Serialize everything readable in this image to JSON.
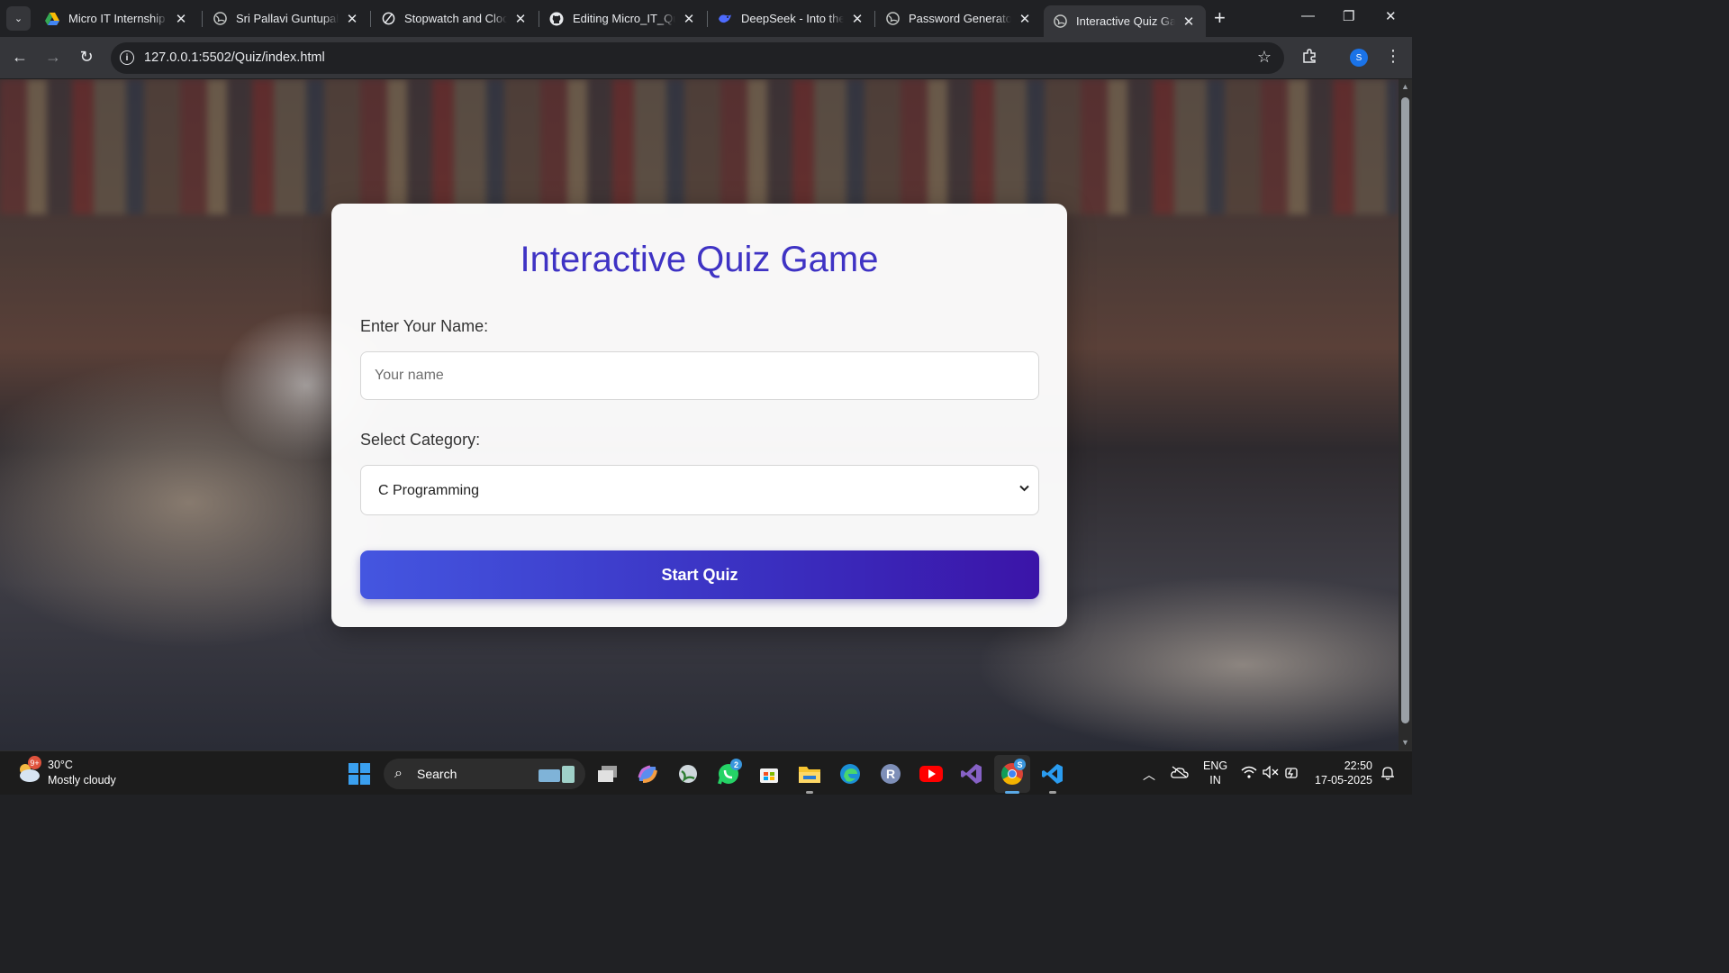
{
  "browser": {
    "tabs": [
      {
        "title": "Micro IT Internship P",
        "favicon": "google-drive-icon"
      },
      {
        "title": "Sri Pallavi Guntupalli",
        "favicon": "globe-icon"
      },
      {
        "title": "Stopwatch and Clock",
        "favicon": "stopwatch-icon"
      },
      {
        "title": "Editing Micro_IT_Qui",
        "favicon": "github-icon"
      },
      {
        "title": "DeepSeek - Into the U",
        "favicon": "deepseek-icon"
      },
      {
        "title": "Password Generator",
        "favicon": "globe-icon"
      },
      {
        "title": "Interactive Quiz Gam",
        "favicon": "globe-icon",
        "active": true
      }
    ],
    "url": "127.0.0.1:5502/Quiz/index.html",
    "profile_initial": "S"
  },
  "quiz": {
    "title": "Interactive Quiz Game",
    "name_label": "Enter Your Name:",
    "name_placeholder": "Your name",
    "name_value": "",
    "category_label": "Select Category:",
    "category_selected": "C Programming",
    "start_button": "Start Quiz",
    "title_color": "#3f33c4"
  },
  "taskbar": {
    "weather_badge": "9+",
    "temperature": "30°C",
    "weather": "Mostly cloudy",
    "search_label": "Search",
    "whatsapp_badge": "2",
    "chrome_badge": "S",
    "language": "ENG",
    "region": "IN",
    "time": "22:50",
    "date": "17-05-2025"
  }
}
